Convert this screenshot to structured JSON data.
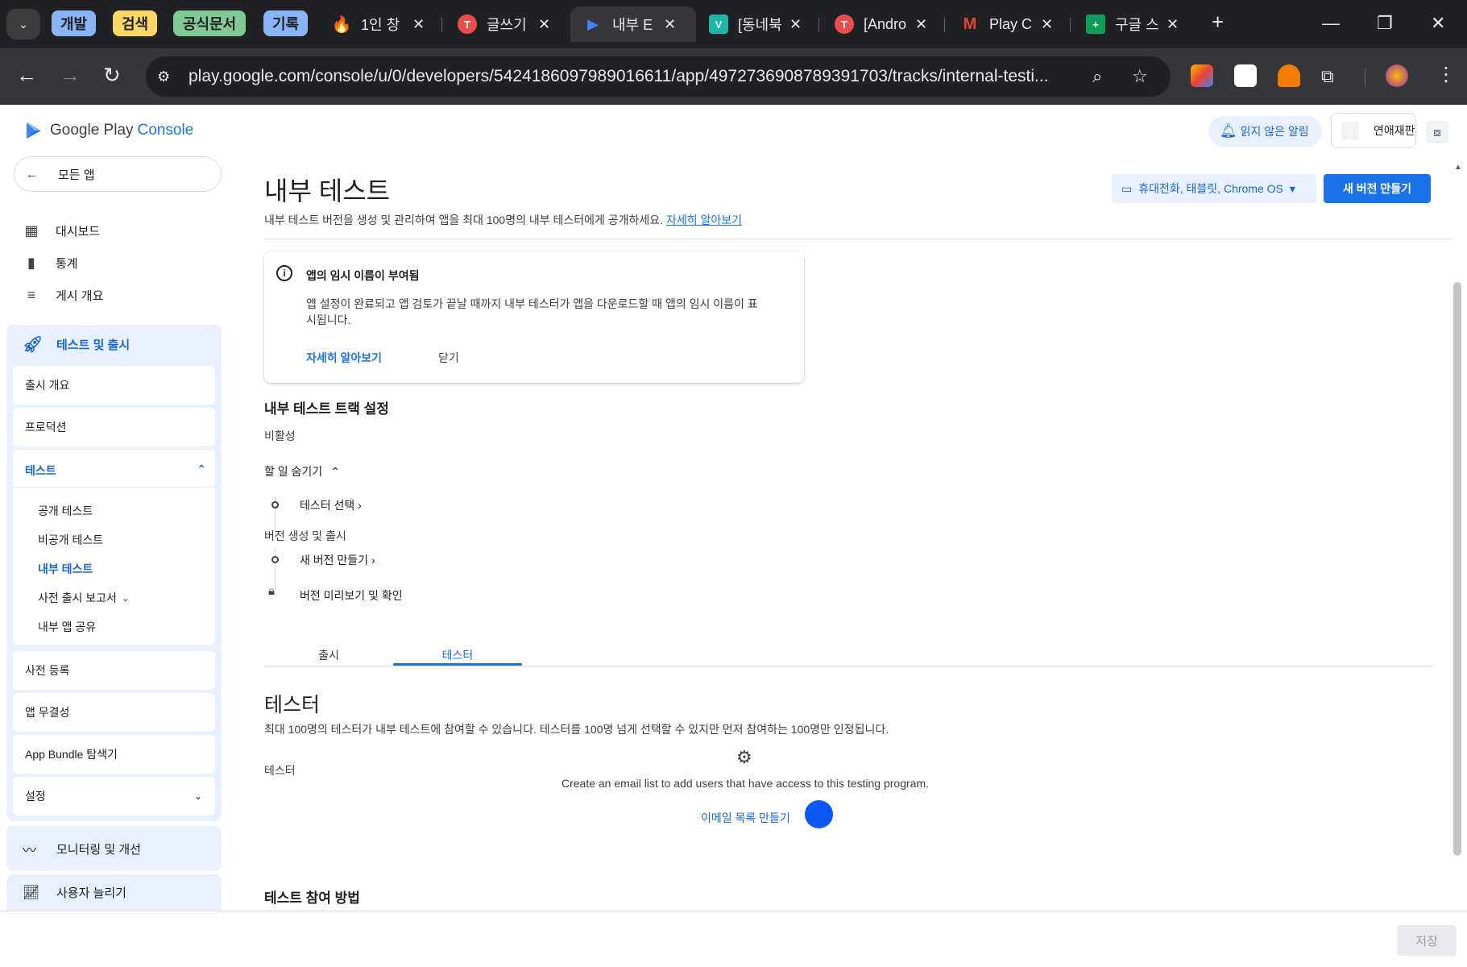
{
  "browser": {
    "groups": [
      {
        "label": "개발",
        "color": "#8ab4f8"
      },
      {
        "label": "검색",
        "color": "#fdd663"
      },
      {
        "label": "공식문서",
        "color": "#81c995"
      },
      {
        "label": "기록",
        "color": "#8ab4f8"
      }
    ],
    "tabs": [
      {
        "title": "1인 창",
        "icon": "fire-icon"
      },
      {
        "title": "글쓰기",
        "icon": "notion-icon"
      },
      {
        "title": "내부 E",
        "icon": "play-console-icon"
      },
      {
        "title": "[동네북",
        "icon": "v-icon"
      },
      {
        "title": "[Andro",
        "icon": "notion-icon"
      },
      {
        "title": "Play C",
        "icon": "gmail-icon"
      },
      {
        "title": "구글 스",
        "icon": "sheets-icon"
      }
    ],
    "new_tab": "+",
    "url": "play.google.com/console/u/0/developers/5424186097989016611/app/4972736908789391703/tracks/internal-testi..."
  },
  "header": {
    "logo_text": "Google Play",
    "logo_console": "Console",
    "notifications": "읽지 않은 알림",
    "account": "연애재판"
  },
  "sidebar": {
    "all_apps": "모든 앱",
    "items": [
      "대시보드",
      "통계",
      "게시 개요"
    ],
    "release_group": "테스트 및 출시",
    "release_items": [
      "출시 개요",
      "프로덕션"
    ],
    "test": "테스트",
    "test_items": [
      "공개 테스트",
      "비공개 테스트",
      "내부 테스트",
      "사전 출시 보고서",
      "내부 앱 공유"
    ],
    "more_items": [
      "사전 등록",
      "앱 무결성",
      "App Bundle 탐색기",
      "설정"
    ],
    "monitor": "모니터링 및 개선",
    "grow": "사용자 늘리기"
  },
  "main": {
    "title": "내부 테스트",
    "description": "내부 테스트 버전을 생성 및 관리하여 앱을 최대 100명의 내부 테스터에게 공개하세요.",
    "learn_more": "자세히 알아보기",
    "device_select": "휴대전화, 태블릿, Chrome OS",
    "new_release": "새 버전 만들기",
    "info": {
      "title": "앱의 임시 이름이 부여됨",
      "body": "앱 설정이 완료되고 앱 검토가 끝날 때까지 내부 테스터가 앱을 다운로드할 때 앱의 임시 이름이 표시됩니다.",
      "learn_more": "자세히 알아보기",
      "close": "닫기"
    },
    "track_settings": "내부 테스트 트랙 설정",
    "track_status": "비활성",
    "hide_tasks": "할 일 숨기기",
    "task_select_testers": "테스터 선택",
    "create_release_heading": "버전 생성 및 출시",
    "task_new_release": "새 버전 만들기",
    "task_preview": "버전 미리보기 및 확인",
    "tabs": [
      "출시",
      "테스터"
    ],
    "testers_title": "테스터",
    "testers_desc": "최대 100명의 테스터가 내부 테스트에 참여할 수 있습니다. 테스터를 100명 넘게 선택할 수 있지만 먼저 참여하는 100명만 인정됩니다.",
    "testers_label": "테스터",
    "empty_message": "Create an email list to add users that have access to this testing program.",
    "create_list": "이메일 목록 만들기",
    "how_to_join": "테스트 참여 방법"
  },
  "footer": {
    "save": "저장"
  },
  "colors": {
    "accent": "#1a73e8",
    "accent_light": "#e8f0fe",
    "chrome_dark": "#202124"
  }
}
